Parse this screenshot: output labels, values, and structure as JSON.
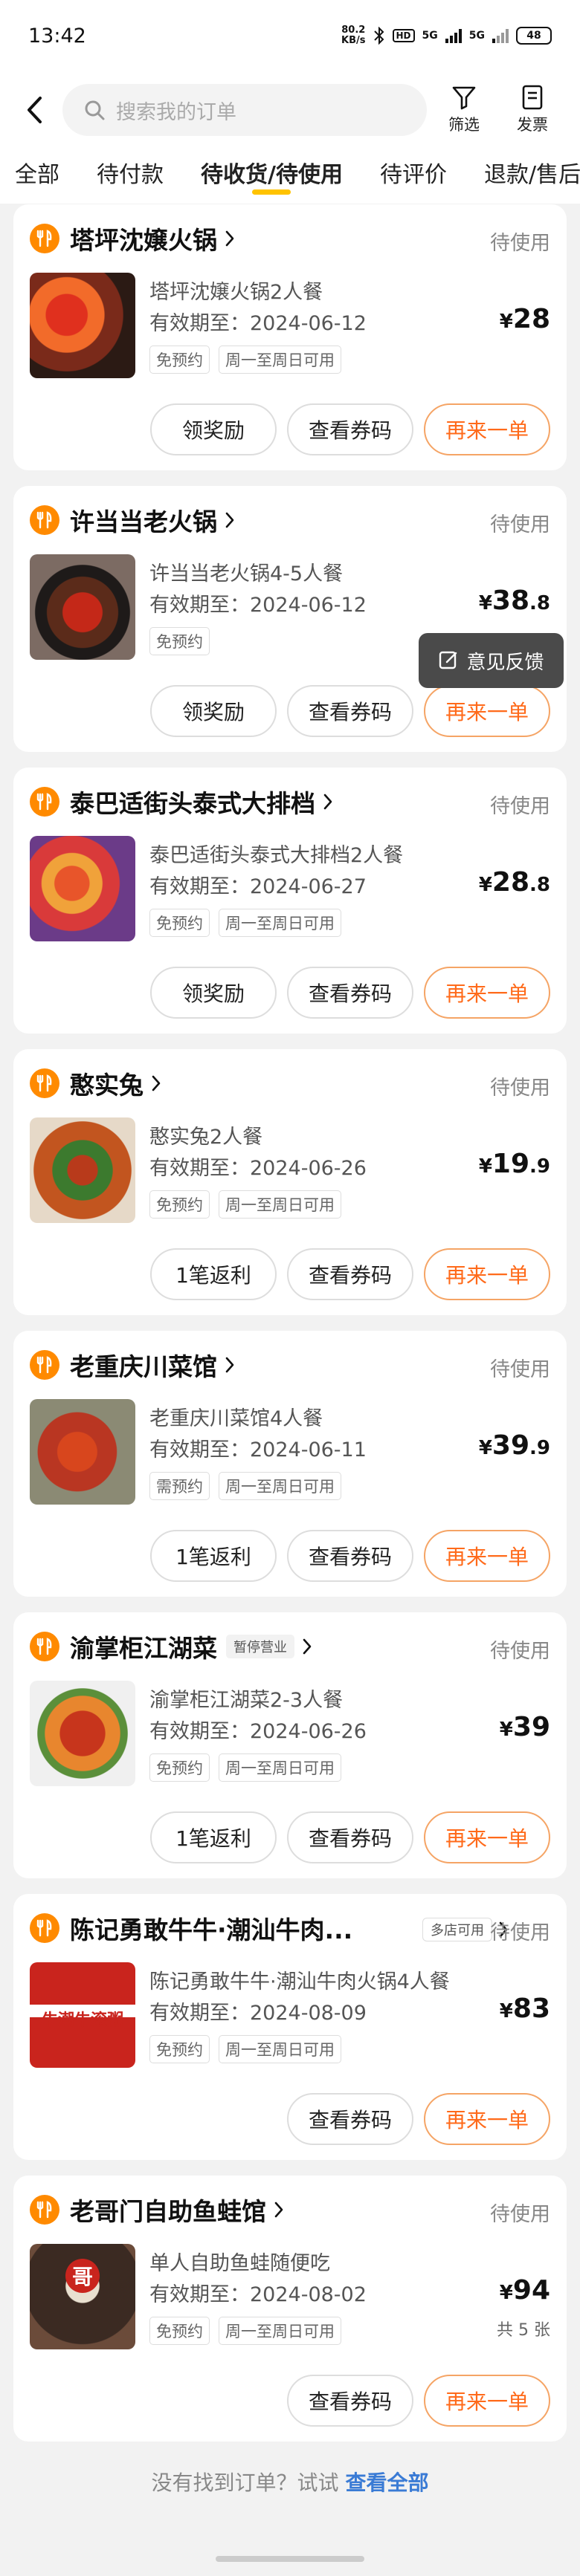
{
  "status_bar": {
    "time": "13:42",
    "speed_value": "80.2",
    "speed_unit": "KB/s",
    "hd": "HD",
    "net1": "5G",
    "net2": "5G",
    "battery": "48"
  },
  "header": {
    "search_placeholder": "搜索我的订单",
    "filter_label": "筛选",
    "invoice_label": "发票"
  },
  "tabs": [
    {
      "label": "全部"
    },
    {
      "label": "待付款"
    },
    {
      "label": "待收货/待使用",
      "active": true
    },
    {
      "label": "待评价"
    },
    {
      "label": "退款/售后"
    }
  ],
  "orders": [
    {
      "shop": "塔坪沈嬢火锅",
      "status": "待使用",
      "title": "塔坪沈嬢火锅2人餐",
      "expiry": "有效期至：2024-06-12",
      "tags": [
        "免预约",
        "周一至周日可用"
      ],
      "price_symbol": "¥",
      "price_int": "28",
      "price_dec": "",
      "buttons": [
        "领奖励",
        "查看券码",
        "再来一单"
      ]
    },
    {
      "shop": "许当当老火锅",
      "status": "待使用",
      "title": "许当当老火锅4-5人餐",
      "expiry": "有效期至：2024-06-12",
      "tags": [
        "免预约"
      ],
      "price_symbol": "¥",
      "price_int": "38",
      "price_dec": ".8",
      "buttons": [
        "领奖励",
        "查看券码",
        "再来一单"
      ]
    },
    {
      "shop": "泰巴适街头泰式大排档",
      "status": "待使用",
      "title": "泰巴适街头泰式大排档2人餐",
      "expiry": "有效期至：2024-06-27",
      "tags": [
        "免预约",
        "周一至周日可用"
      ],
      "price_symbol": "¥",
      "price_int": "28",
      "price_dec": ".8",
      "buttons": [
        "领奖励",
        "查看券码",
        "再来一单"
      ]
    },
    {
      "shop": "憨实兔",
      "status": "待使用",
      "title": "憨实兔2人餐",
      "expiry": "有效期至：2024-06-26",
      "tags": [
        "免预约",
        "周一至周日可用"
      ],
      "price_symbol": "¥",
      "price_int": "19",
      "price_dec": ".9",
      "buttons": [
        "1笔返利",
        "查看券码",
        "再来一单"
      ]
    },
    {
      "shop": "老重庆川菜馆",
      "status": "待使用",
      "title": "老重庆川菜馆4人餐",
      "expiry": "有效期至：2024-06-11",
      "tags": [
        "需预约",
        "周一至周日可用"
      ],
      "price_symbol": "¥",
      "price_int": "39",
      "price_dec": ".9",
      "buttons": [
        "1笔返利",
        "查看券码",
        "再来一单"
      ]
    },
    {
      "shop": "渝掌柜江湖菜",
      "badge": "暂停营业",
      "status": "待使用",
      "title": "渝掌柜江湖菜2-3人餐",
      "expiry": "有效期至：2024-06-26",
      "tags": [
        "免预约",
        "周一至周日可用"
      ],
      "price_symbol": "¥",
      "price_int": "39",
      "price_dec": "",
      "buttons": [
        "1笔返利",
        "查看券码",
        "再来一单"
      ]
    },
    {
      "shop": "陈记勇敢牛牛·潮汕牛肉...",
      "multi": "多店可用",
      "status": "待使用",
      "title": "陈记勇敢牛牛·潮汕牛肉火锅4人餐",
      "expiry": "有效期至：2024-08-09",
      "tags": [
        "免预约",
        "周一至周日可用"
      ],
      "price_symbol": "¥",
      "price_int": "83",
      "price_dec": "",
      "buttons": [
        "查看券码",
        "再来一单"
      ],
      "thumb_text": "牛潮牛滚粥"
    },
    {
      "shop": "老哥门自助鱼蛙馆",
      "status": "待使用",
      "title": "单人自助鱼蛙随便吃",
      "expiry": "有效期至：2024-08-02",
      "tags": [
        "免预约",
        "周一至周日可用"
      ],
      "price_symbol": "¥",
      "price_int": "94",
      "price_dec": "",
      "qty": "共 5 张",
      "buttons": [
        "查看券码",
        "再来一单"
      ],
      "thumb_text": "哥"
    }
  ],
  "feedback": {
    "label": "意见反馈"
  },
  "footer": {
    "text": "没有找到订单？试试",
    "link": "查看全部"
  },
  "colors": {
    "accent": "#ff6a1a",
    "tab_indicator": "#ffc300",
    "shop_icon": "#ff8a00",
    "link": "#3a7bd5"
  }
}
